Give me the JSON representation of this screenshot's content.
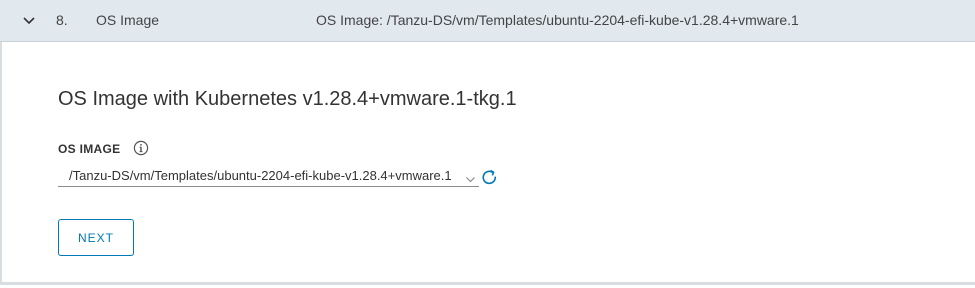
{
  "step": {
    "number": "8.",
    "title": "OS Image",
    "summary": "OS Image: /Tanzu-DS/vm/Templates/ubuntu-2204-efi-kube-v1.28.4+vmware.1",
    "expanded_icon": "chevron-down-icon"
  },
  "content": {
    "heading": "OS Image with Kubernetes v1.28.4+vmware.1-tkg.1",
    "os_image_field": {
      "label": "OS IMAGE",
      "info_icon": "info-icon",
      "value": "/Tanzu-DS/vm/Templates/ubuntu-2204-efi-kube-v1.28.4+vmware.1",
      "refresh_icon": "refresh-icon"
    },
    "next_label": "NEXT"
  },
  "colors": {
    "header_bg": "#e1e8ee",
    "accent": "#0079b8",
    "text": "#333333"
  }
}
